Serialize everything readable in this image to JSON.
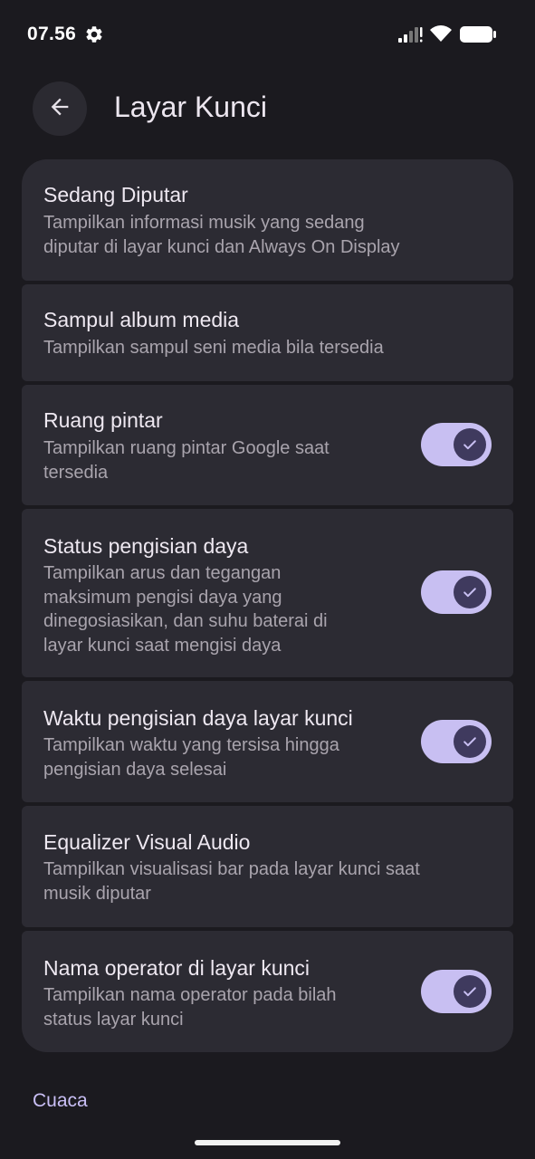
{
  "status_bar": {
    "time": "07.56",
    "icons": [
      "gear-icon",
      "signal-icon",
      "wifi-icon",
      "battery-icon"
    ]
  },
  "header": {
    "back_icon": "arrow-left-icon",
    "title": "Layar Kunci"
  },
  "settings": [
    {
      "title": "Sedang Diputar",
      "description_lines": [
        "Tampilkan informasi musik yang sedang",
        "diputar di layar kunci dan Always On Display"
      ],
      "toggle": null
    },
    {
      "title": "Sampul album media",
      "description_lines": [
        "Tampilkan sampul seni media bila tersedia"
      ],
      "toggle": null
    },
    {
      "title": "Ruang pintar",
      "description_lines": [
        "Tampilkan ruang pintar Google saat",
        "tersedia"
      ],
      "toggle": true
    },
    {
      "title": "Status pengisian daya",
      "description_lines": [
        "Tampilkan arus dan tegangan",
        "maksimum pengisi daya yang",
        "dinegosiasikan, dan suhu baterai di",
        "layar kunci saat mengisi daya"
      ],
      "toggle": true
    },
    {
      "title": "Waktu pengisian daya layar kunci",
      "description_lines": [
        "Tampilkan waktu yang tersisa hingga",
        "pengisian daya selesai"
      ],
      "toggle": true
    },
    {
      "title": "Equalizer Visual Audio",
      "description_lines": [
        "Tampilkan visualisasi bar pada layar kunci saat",
        "musik diputar"
      ],
      "toggle": null
    },
    {
      "title": "Nama operator di layar kunci",
      "description_lines": [
        "Tampilkan nama operator pada bilah",
        "status layar kunci"
      ],
      "toggle": true
    }
  ],
  "section_link": "Cuaca",
  "colors": {
    "background": "#1b1a1f",
    "card": "#2c2b33",
    "accent": "#c8bff2",
    "toggle_knob": "#3f3a5e",
    "link": "#c9bff5"
  }
}
